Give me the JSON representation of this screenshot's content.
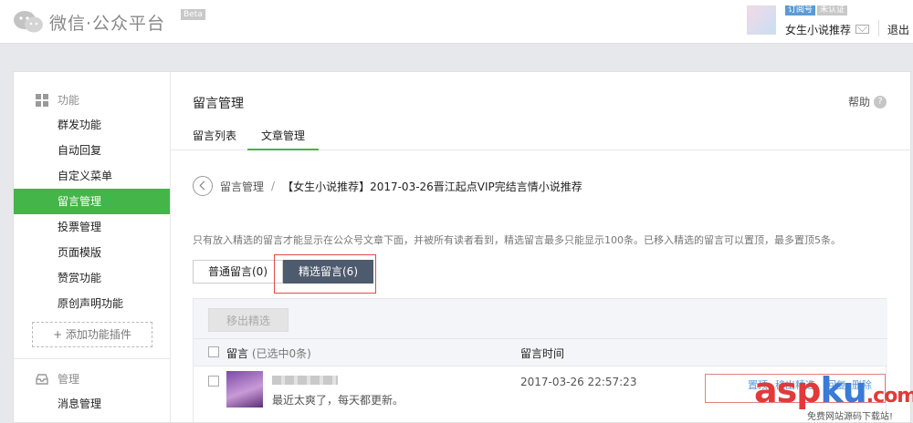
{
  "header": {
    "logo_text": "微信·公众平台",
    "beta": "Beta",
    "tag_subscription": "订阅号",
    "tag_unverified": "未认证",
    "account_name": "女生小说推荐",
    "logout": "退出"
  },
  "sidebar": {
    "section_function": "功能",
    "items": [
      "群发功能",
      "自动回复",
      "自定义菜单",
      "留言管理",
      "投票管理",
      "页面模版",
      "赞赏功能",
      "原创声明功能"
    ],
    "active_index": 3,
    "add_plugin": "+ 添加功能插件",
    "section_manage": "管理",
    "manage_items": [
      "消息管理"
    ]
  },
  "content": {
    "page_title": "留言管理",
    "help": "帮助",
    "help_icon": "?",
    "tabs": [
      "留言列表",
      "文章管理"
    ],
    "active_tab": 1,
    "breadcrumb_root": "留言管理",
    "breadcrumb_sep": "/",
    "breadcrumb_current": "【女生小说推荐】2017-03-26晋江起点VIP完结言情小说推荐",
    "tip": "只有放入精选的留言才能显示在公众号文章下面，并被所有读者看到，精选留言最多只能显示100条。已移入精选的留言可以置顶，最多置顶5条。",
    "switch_normal": "普通留言(0)",
    "switch_featured": "精选留言(6)",
    "move_out_button": "移出精选",
    "col_comment": "留言",
    "col_selected": "(已选中0条)",
    "col_time": "留言时间",
    "rows": [
      {
        "text": "最近太爽了，每天都更新。",
        "time": "2017-03-26 22:57:23",
        "ops": [
          "置顶",
          "移出精选",
          "回复",
          "删除"
        ]
      }
    ]
  },
  "watermark": {
    "brand_a": "asp",
    "brand_b": "ku",
    "brand_c": ".com",
    "sub": "免费网站源码下载站!"
  },
  "colors": {
    "accent_green": "#44b549",
    "dark_button": "#4e5a6d",
    "highlight_red": "#e04b4b",
    "link_blue": "#5b9bd5"
  }
}
